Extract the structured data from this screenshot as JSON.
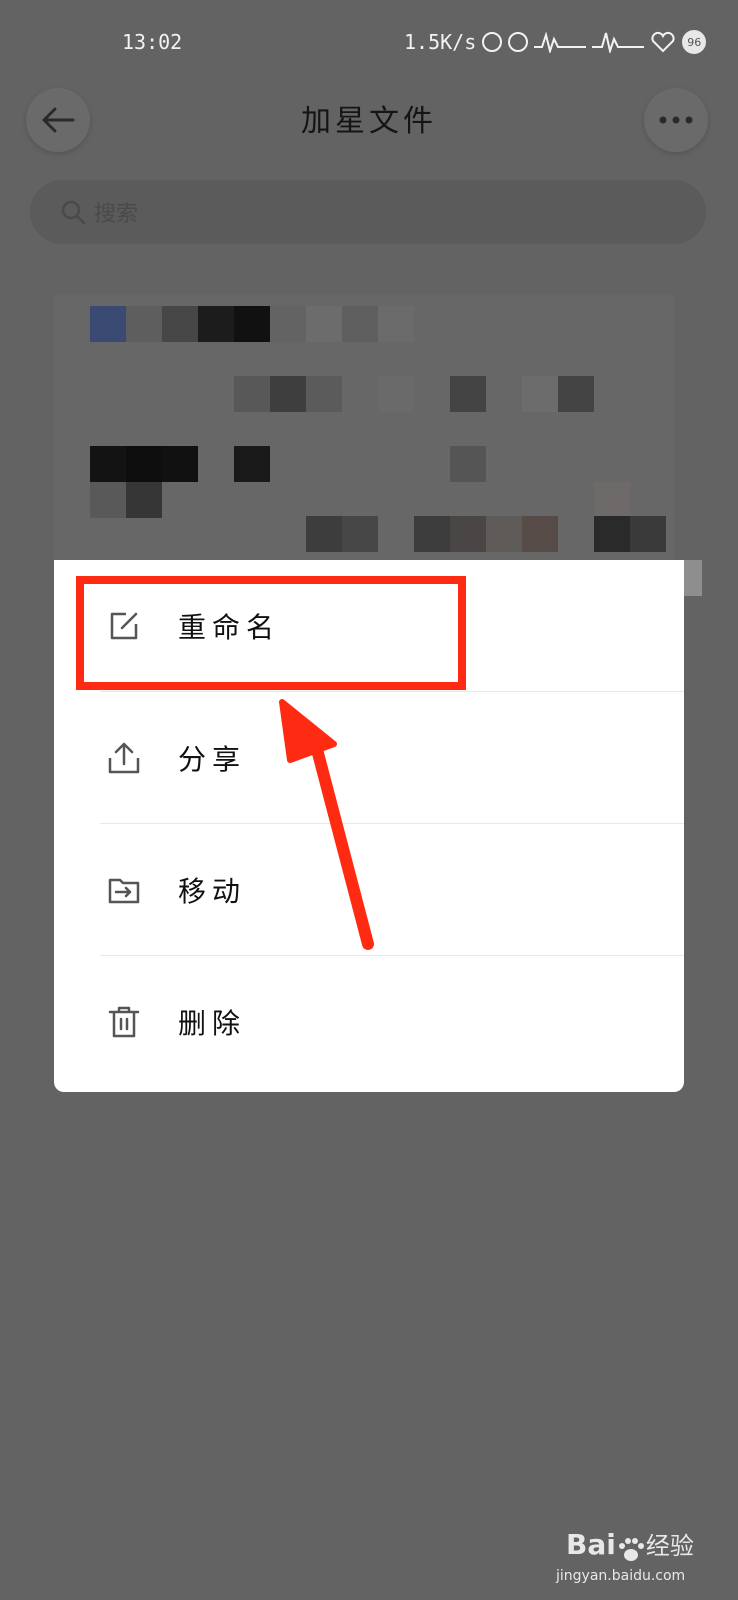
{
  "status_bar": {
    "time": "13:02",
    "net_speed": "1.5K/s",
    "battery": "96"
  },
  "header": {
    "title": "加星文件",
    "back_icon": "arrow-left-icon",
    "more_icon": "more-horizontal-icon"
  },
  "search": {
    "placeholder": "搜索"
  },
  "menu": {
    "items": [
      {
        "label": "重命名",
        "icon": "edit-icon"
      },
      {
        "label": "分享",
        "icon": "share-icon"
      },
      {
        "label": "移动",
        "icon": "move-folder-icon"
      },
      {
        "label": "删除",
        "icon": "trash-icon"
      }
    ]
  },
  "annotation": {
    "highlight_color": "#ff2a12"
  },
  "watermark": {
    "brand": "Bai",
    "brand2": "经验",
    "url": "jingyan.baidu.com"
  }
}
